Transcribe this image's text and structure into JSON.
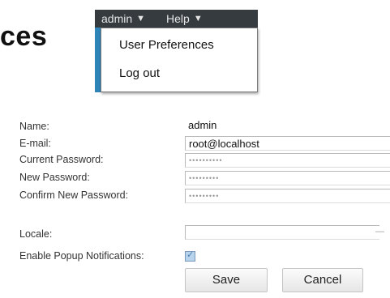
{
  "page": {
    "title_fragment": "ces"
  },
  "menubar": {
    "admin_label": "admin",
    "help_label": "Help",
    "dropdown_arrow": "▼"
  },
  "dropdown": {
    "items": [
      {
        "label": "User Preferences"
      },
      {
        "label": "Log out"
      }
    ]
  },
  "form": {
    "name_label": "Name:",
    "name_value": "admin",
    "email_label": "E-mail:",
    "email_value": "root@localhost",
    "current_password_label": "Current Password:",
    "current_password_mask": "••••••••••",
    "new_password_label": "New Password:",
    "new_password_mask": "•••••••••",
    "confirm_password_label": "Confirm New Password:",
    "confirm_password_mask": "•••••••••",
    "locale_label": "Locale:",
    "locale_value": "",
    "notifications_label": "Enable Popup Notifications:",
    "notifications_checked": true,
    "save_label": "Save",
    "cancel_label": "Cancel"
  },
  "colors": {
    "menubar_bg": "#363b3f",
    "accent_blue": "#2f84b8",
    "checkbox_fill": "#b8d3ec"
  },
  "icons": {
    "menu_arrow": "chevron-down-icon",
    "checkbox": "checkmark-icon",
    "select": "select-arrow-icon"
  }
}
